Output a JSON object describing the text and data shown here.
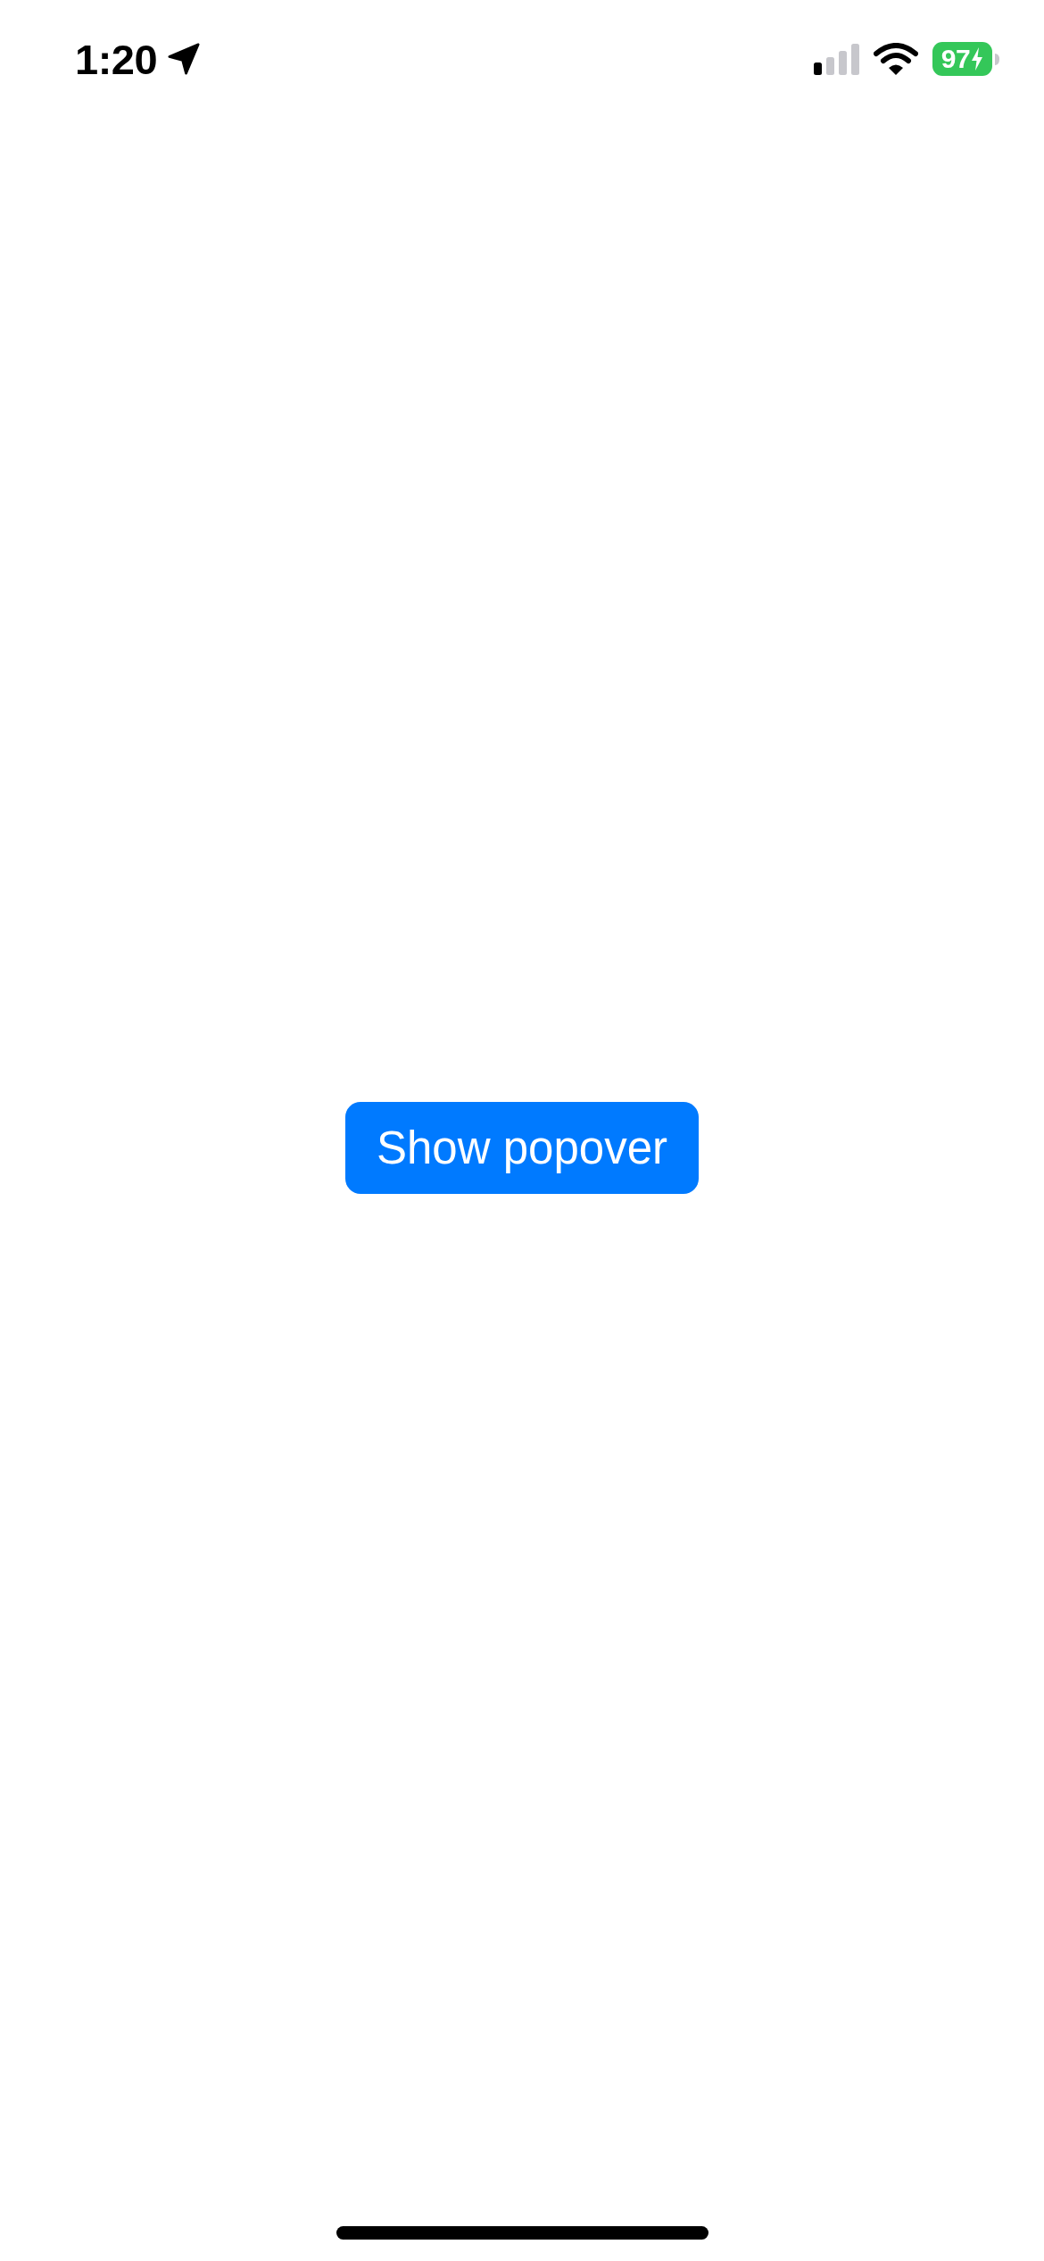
{
  "status_bar": {
    "time": "1:20",
    "location_active": true,
    "battery": {
      "percent": "97",
      "charging": true
    }
  },
  "main": {
    "button": {
      "label": "Show popover"
    }
  },
  "home_indicator": {
    "visible": true
  }
}
